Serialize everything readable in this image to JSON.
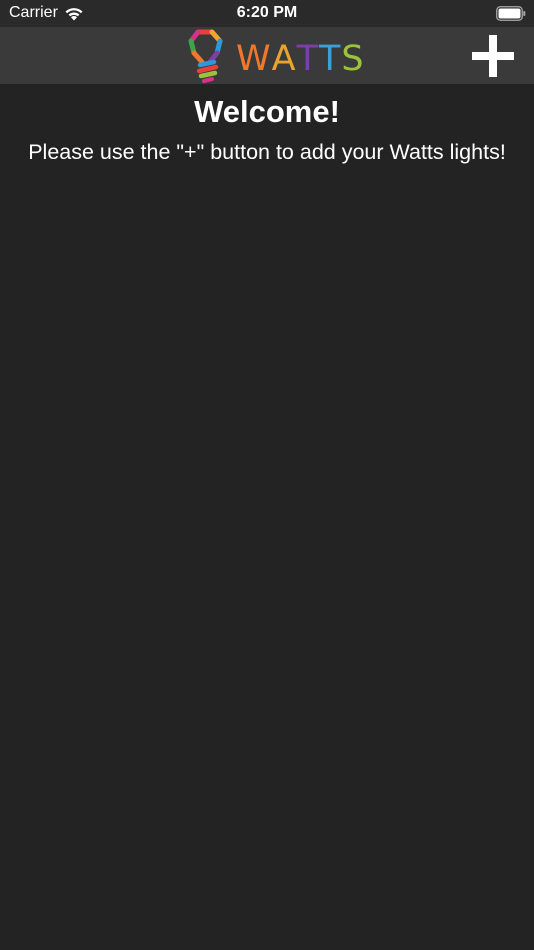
{
  "status_bar": {
    "carrier": "Carrier",
    "time": "6:20 PM",
    "wifi_icon": "wifi-icon",
    "battery_icon": "battery-icon"
  },
  "nav_bar": {
    "logo_letters": [
      "W",
      "A",
      "T",
      "T",
      "S"
    ],
    "logo_letter_colors": [
      "#f0772b",
      "#e8a330",
      "#7a3fa8",
      "#3b9fd8",
      "#9ac23c"
    ],
    "logo_icon": "lightbulb-logo-icon",
    "add_icon": "plus-icon",
    "background_color": "#3a3a3a"
  },
  "content": {
    "title": "Welcome!",
    "message": "Please use the \"+\" button to add your Watts lights!",
    "background_color": "#232323"
  }
}
